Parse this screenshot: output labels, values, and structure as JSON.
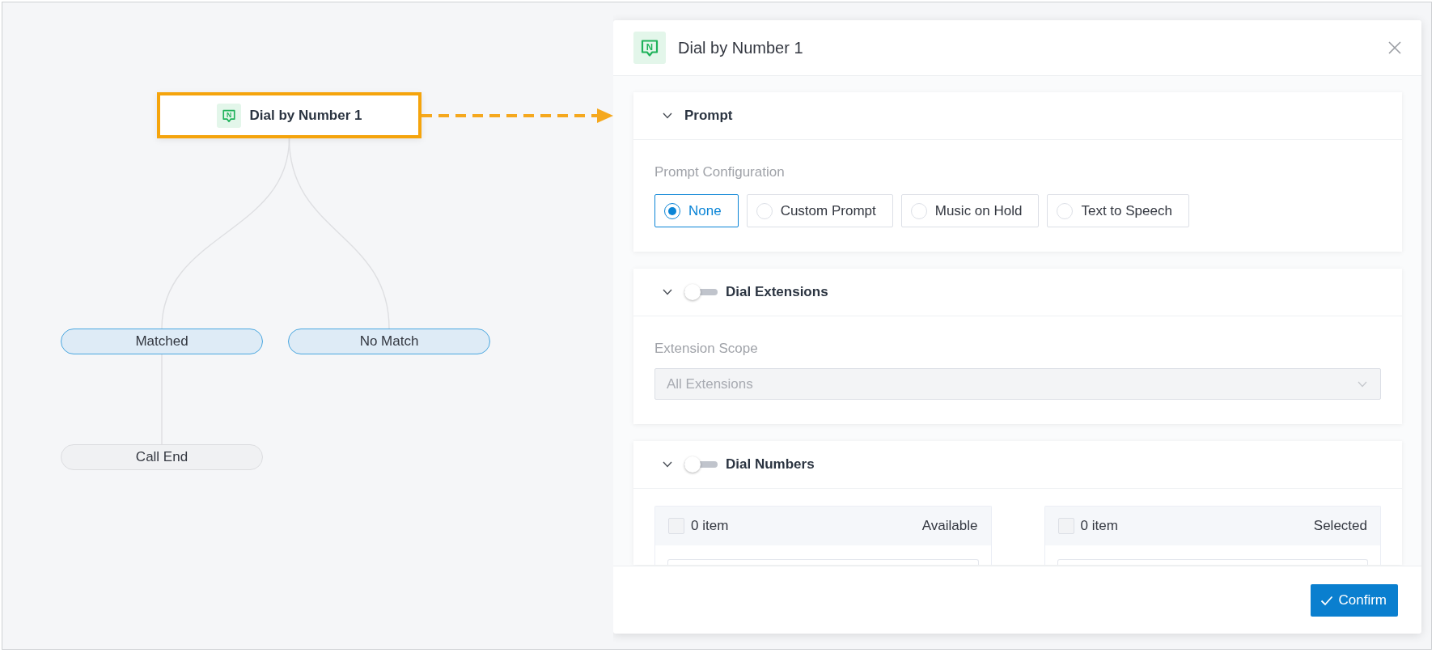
{
  "canvas": {
    "flow": {
      "label": "Dial by Number 1",
      "icon_letter": "N",
      "kind": "action",
      "highlighted": true,
      "children": [
        {
          "label": "Matched",
          "kind": "branch",
          "highlighted": false,
          "children": [
            {
              "label": "Call End",
              "kind": "end",
              "highlighted": false
            }
          ]
        },
        {
          "label": "No Match",
          "kind": "branch",
          "highlighted": false
        }
      ]
    }
  },
  "panel": {
    "icon_letter": "N",
    "title": "Dial by Number 1",
    "sections": [
      {
        "kind": "radio",
        "title": "Prompt",
        "expanded": true,
        "field_label": "Prompt Configuration",
        "options": [
          {
            "label": "None",
            "selected": true
          },
          {
            "label": "Custom Prompt",
            "selected": false
          },
          {
            "label": "Music on Hold",
            "selected": false
          },
          {
            "label": "Text to Speech",
            "selected": false
          }
        ]
      },
      {
        "kind": "select",
        "title": "Dial Extensions",
        "expanded": true,
        "enabled": false,
        "field_label": "Extension Scope",
        "value": "All Extensions",
        "disabled": true
      },
      {
        "kind": "transfer",
        "title": "Dial Numbers",
        "expanded": true,
        "enabled": false,
        "lists": [
          {
            "count": "0 item",
            "title": "Available",
            "checked": false
          },
          {
            "count": "0 item",
            "title": "Selected",
            "checked": false
          }
        ]
      }
    ],
    "confirm": "Confirm"
  }
}
